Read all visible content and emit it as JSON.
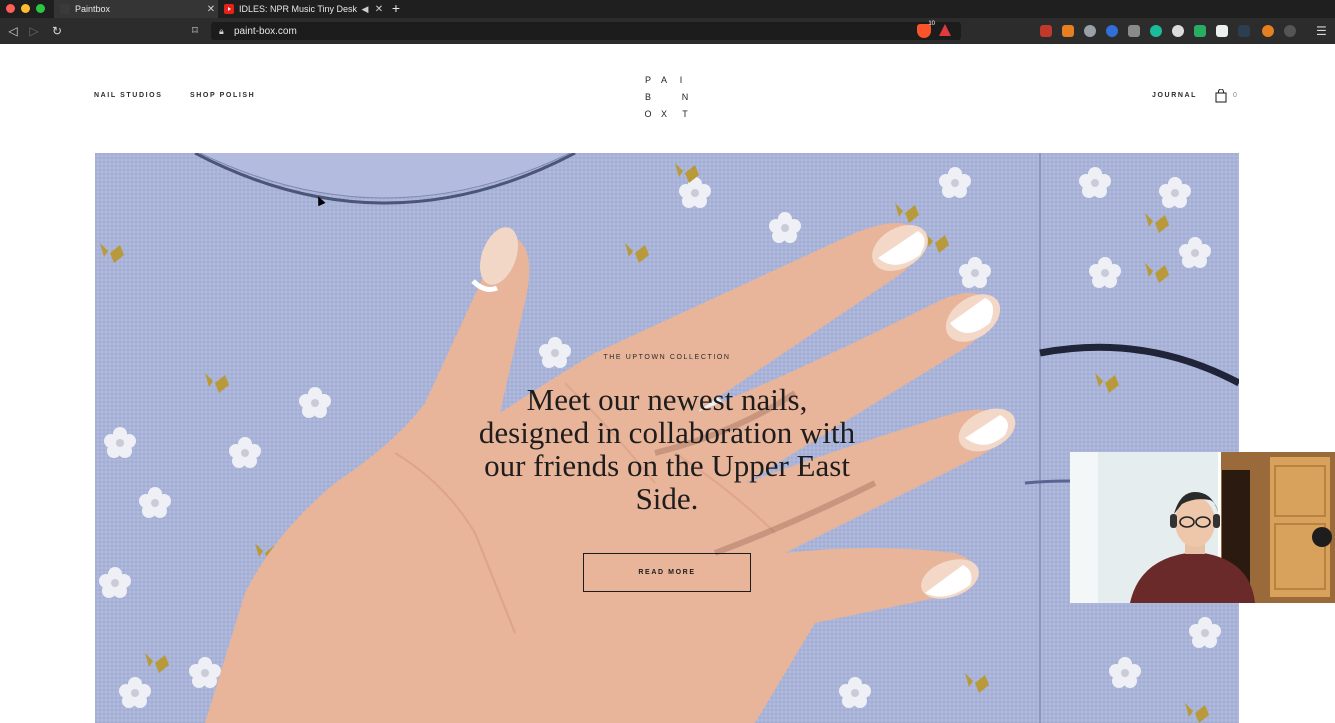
{
  "browser": {
    "tabs": [
      {
        "title": "Paintbox",
        "active": true,
        "favicon": "paintbox-favicon"
      },
      {
        "title": "IDLES: NPR Music Tiny Desk",
        "active": false,
        "favicon": "youtube-favicon"
      }
    ],
    "url": "paint-box.com",
    "brave_badge": "10"
  },
  "site": {
    "nav_left": [
      "NAIL STUDIOS",
      "SHOP POLISH"
    ],
    "logo_letters": [
      "P",
      "A",
      "I",
      "B",
      "N",
      "O",
      "X",
      "T"
    ],
    "nav_right": {
      "journal": "JOURNAL",
      "cart_count": "0"
    }
  },
  "hero": {
    "eyebrow": "THE UPTOWN COLLECTION",
    "headline": "Meet our newest nails, designed in collaboration with our friends on the Upper East Side.",
    "cta": "READ MORE"
  },
  "colors": {
    "sweater": "#aab4d8",
    "skin": "#e8b49a",
    "nail": "#f6ede4",
    "nail_tip": "#ffffff",
    "flower": "#eef0f6",
    "leaf": "#b89a3a"
  }
}
